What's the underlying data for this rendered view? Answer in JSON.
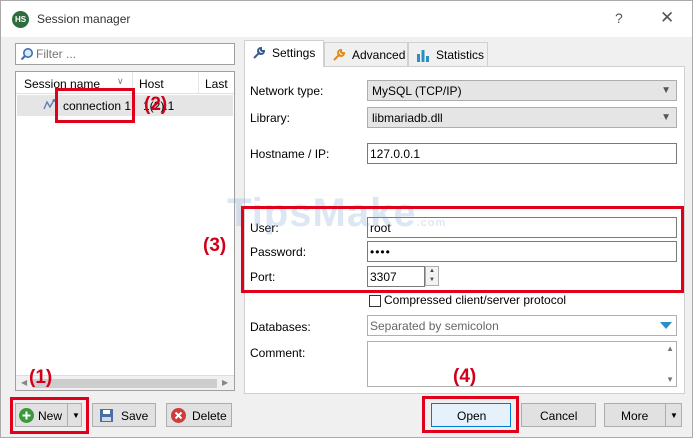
{
  "window": {
    "title": "Session manager",
    "help_glyph": "?",
    "close_glyph": "✕",
    "app_icon_text": "HS"
  },
  "left_pane": {
    "filter_placeholder": "Filter ...",
    "columns": [
      "Session name",
      "Host",
      "Last ."
    ],
    "row": {
      "name": "connection 1",
      "host": "1(2).1"
    }
  },
  "tabs": [
    {
      "label": "Settings",
      "icon": "wrench-icon",
      "active": true
    },
    {
      "label": "Advanced",
      "icon": "wrench-orange-icon",
      "active": false
    },
    {
      "label": "Statistics",
      "icon": "bar-chart-icon",
      "active": false
    }
  ],
  "settings": {
    "network_type_label": "Network type:",
    "network_type_value": "MySQL (TCP/IP)",
    "library_label": "Library:",
    "library_value": "libmariadb.dll",
    "hostname_label": "Hostname / IP:",
    "hostname_value": "127.0.0.1",
    "user_label": "User:",
    "user_value": "root",
    "password_label": "Password:",
    "password_value": "••••",
    "port_label": "Port:",
    "port_value": "3307",
    "compressed_label": "Compressed client/server protocol",
    "databases_label": "Databases:",
    "databases_placeholder": "Separated by semicolon",
    "comment_label": "Comment:"
  },
  "buttons": {
    "new": "New",
    "save": "Save",
    "delete": "Delete",
    "open": "Open",
    "cancel": "Cancel",
    "more": "More"
  },
  "annotations": [
    "(1)",
    "(2)",
    "(3)",
    "(4)"
  ],
  "watermark": {
    "main": "TipsMake",
    "sub": ".com"
  },
  "colors": {
    "annotation_red": "#e0001a",
    "new_icon_green": "#3a9a3a",
    "delete_icon_red": "#d23b3b"
  }
}
